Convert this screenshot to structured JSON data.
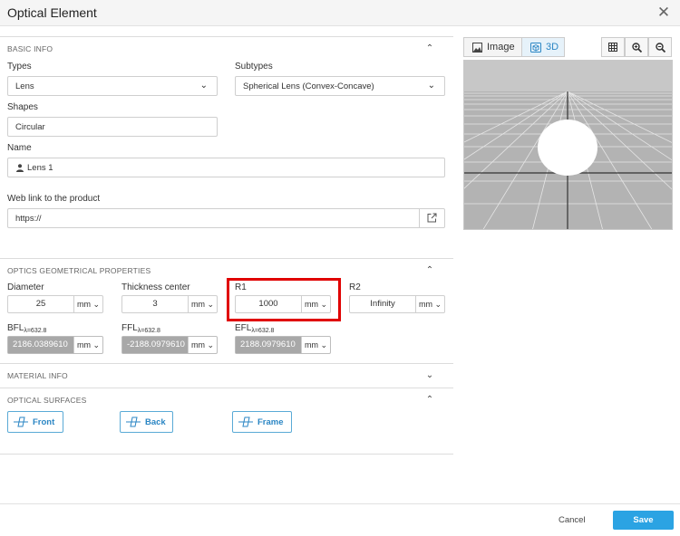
{
  "window": {
    "title": "Optical Element",
    "close_glyph": "✕"
  },
  "basic_info": {
    "section_label": "BASIC INFO",
    "types_label": "Types",
    "types_value": "Lens",
    "subtypes_label": "Subtypes",
    "subtypes_value": "Spherical Lens (Convex-Concave)",
    "shapes_label": "Shapes",
    "shapes_value": "Circular",
    "name_label": "Name",
    "name_value": "Lens 1",
    "weblink_label": "Web link to the product",
    "weblink_value": "https://"
  },
  "geometry": {
    "section_label": "OPTICS GEOMETRICAL PROPERTIES",
    "diameter": {
      "label": "Diameter",
      "value": "25",
      "unit": "mm"
    },
    "thickness": {
      "label": "Thickness center",
      "value": "3",
      "unit": "mm"
    },
    "r1": {
      "label": "R1",
      "value": "1000",
      "unit": "mm"
    },
    "r2": {
      "label": "R2",
      "value": "Infinity",
      "unit": "mm"
    },
    "bfl": {
      "label": "BFL",
      "sub": "λ=632.8",
      "value": "2186.0389610",
      "unit": "mm"
    },
    "ffl": {
      "label": "FFL",
      "sub": "λ=632.8",
      "value": "-2188.0979610",
      "unit": "mm"
    },
    "efl": {
      "label": "EFL",
      "sub": "λ=632.8",
      "value": "2188.0979610",
      "unit": "mm"
    }
  },
  "material": {
    "section_label": "MATERIAL INFO"
  },
  "surfaces": {
    "section_label": "OPTICAL SURFACES",
    "front_label": "Front",
    "back_label": "Back",
    "frame_label": "Frame"
  },
  "viewer": {
    "image_tab": "Image",
    "view3d_tab": "3D",
    "active_tab": "3D",
    "tools": [
      "grid-icon",
      "zoom-in-icon",
      "zoom-out-icon"
    ]
  },
  "footer": {
    "cancel_label": "Cancel",
    "save_label": "Save"
  },
  "colors": {
    "accent": "#2ba3e3",
    "highlight": "#e00000",
    "readonly_bg": "#a8a8a8"
  }
}
